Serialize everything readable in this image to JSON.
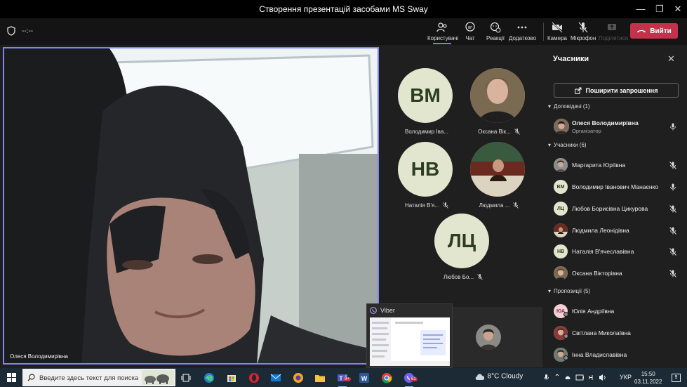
{
  "window": {
    "title": "Створення презентацій засобами MS Sway",
    "minimize": "—",
    "maximize": "❐",
    "close": "✕"
  },
  "toolbar": {
    "timer": "--:--",
    "users": "Користувачі",
    "chat": "Чат",
    "reactions": "Реакції",
    "more": "Додатково",
    "camera": "Камера",
    "microphone": "Мікрофон",
    "share": "Поділитися",
    "leave": "Вийти"
  },
  "stage": {
    "main_speaker": "Олеся Володимирівна",
    "tiles": [
      {
        "initials": "ВМ",
        "name": "Володимир Іва..."
      },
      {
        "initials": "",
        "name": "Оксана Вік..."
      },
      {
        "initials": "НВ",
        "name": "Наталія В'я..."
      },
      {
        "initials": "",
        "name": "Людмила ..."
      },
      {
        "initials": "ЛЦ",
        "name": "Любов Бо..."
      }
    ]
  },
  "viber": {
    "label": "Viber"
  },
  "panel": {
    "title": "Учасники",
    "share_invite": "Поширити запрошення",
    "sections": {
      "presenters": "Доповідачі (1)",
      "attendees": "Учасники (6)",
      "suggestions": "Пропозиції (5)"
    },
    "presenter": {
      "name": "Олеся Володимирівна",
      "role": "Організатор"
    },
    "attendees": [
      {
        "initials": "",
        "name": "Маргарита Юріївна",
        "muted": true
      },
      {
        "initials": "ВМ",
        "name": "Володимир Іванович Манаєнко",
        "muted": false
      },
      {
        "initials": "ЛЦ",
        "name": "Любов Борисівна Цикурова",
        "muted": true
      },
      {
        "initials": "",
        "name": "Людмила Леонідівна",
        "muted": true
      },
      {
        "initials": "НВ",
        "name": "Наталія В'ячеславівна",
        "muted": true
      },
      {
        "initials": "",
        "name": "Оксана Вікторівна",
        "muted": true
      }
    ],
    "suggestions": [
      {
        "initials": "ЮА",
        "name": "Юлія Андріївна"
      },
      {
        "initials": "",
        "name": "Світлана Миколаївна"
      },
      {
        "initials": "",
        "name": "Інна Владиславівна"
      }
    ]
  },
  "taskbar": {
    "search_placeholder": "Введите здесь текст для поиска",
    "teams_badge": "9+",
    "viber_badge": "61",
    "weather": "8°C  Cloudy",
    "lang": "УКР",
    "time": "15:50",
    "date": "03.11.2022",
    "notifications": "9"
  },
  "colors": {
    "accent": "#7f85f5",
    "leave": "#c4314b",
    "avatar_bg": "#e3e6cf"
  }
}
